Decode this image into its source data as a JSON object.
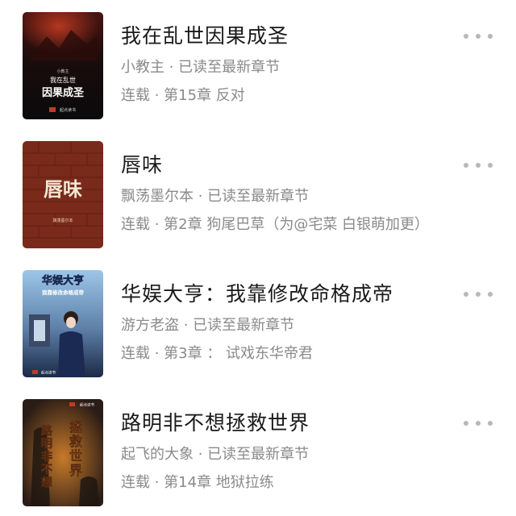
{
  "books": [
    {
      "title": "我在乱世因果成圣",
      "author": "小教主",
      "status": "已读至最新章节",
      "progress": "连载 · 第15章 反对",
      "cover": {
        "title_line1": "我在乱世",
        "title_line2": "因果成圣",
        "author": "小教主",
        "publisher": "起点读书",
        "colors": {
          "top": "#4a1410",
          "mid": "#1a0c0c",
          "bottom": "#0a0a0c",
          "accent": "#c23a22"
        }
      },
      "more_icon": "more-dots-icon"
    },
    {
      "title": "唇味",
      "author": "飘荡墨尔本",
      "status": "已读至最新章节",
      "progress": "连载 · 第2章 狗尾巴草（为@宅菜 白银萌加更）",
      "cover": {
        "title": "唇味",
        "subtitle": "飘荡墨尔本",
        "colors": {
          "bg": "#7a2a1a",
          "brick": "#5e1e12",
          "text": "#f3e6d3"
        }
      },
      "more_icon": "more-dots-icon"
    },
    {
      "title": "华娱大亨：我靠修改命格成帝",
      "author": "游方老盗",
      "status": "已读至最新章节",
      "progress": "连载 · 第3章 ： 试戏东华帝君",
      "cover": {
        "title": "华娱大亨",
        "subtitle": "我靠修改命格成帝",
        "publisher": "起点读书",
        "colors": {
          "sky": "#9cc6e8",
          "coat": "#1b2a52",
          "text": "#ffffff"
        }
      },
      "more_icon": "more-dots-icon"
    },
    {
      "title": "路明非不想拯救世界",
      "author": "起飞的大象",
      "status": "已读至最新章节",
      "progress": "连载 · 第14章 地狱拉练",
      "cover": {
        "title_chars": [
          "路",
          "明",
          "非",
          "不",
          "想",
          "拯",
          "救",
          "世",
          "界"
        ],
        "publisher": "起点读书",
        "colors": {
          "bg": "#3a2a20",
          "glow": "#c77a2a",
          "text": "#f7d56a"
        }
      },
      "more_icon": "more-dots-icon"
    }
  ]
}
